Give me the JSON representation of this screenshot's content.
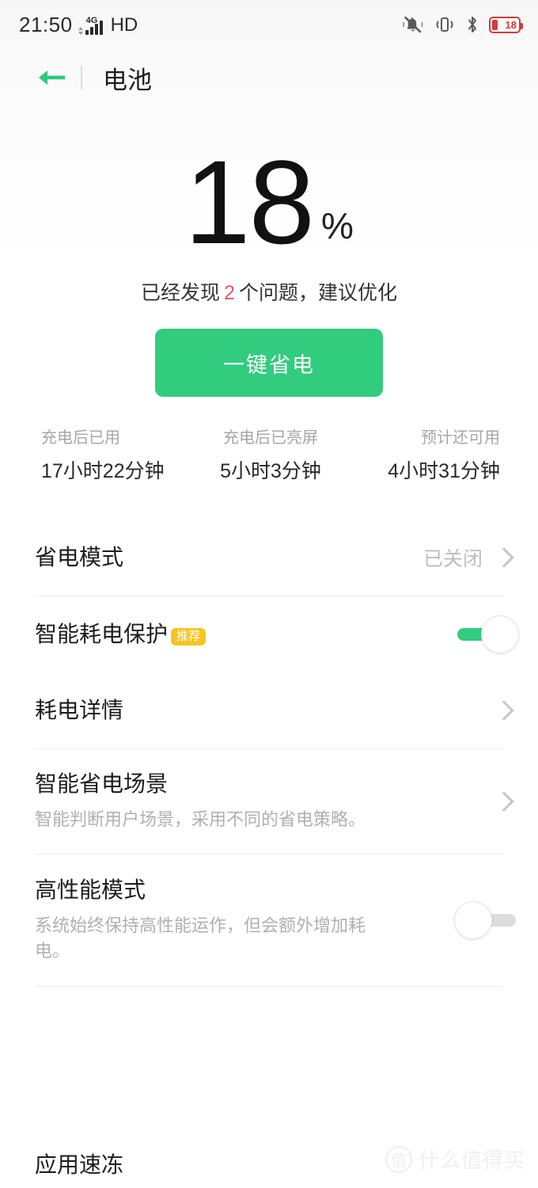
{
  "status_bar": {
    "time": "21:50",
    "network_type": "4G",
    "voice_label": "HD",
    "battery_percent": "18",
    "icons": [
      "ringer-mute-icon",
      "vibrate-icon",
      "bluetooth-icon",
      "battery-icon"
    ]
  },
  "app_bar": {
    "back_label": "back-arrow",
    "title": "电池"
  },
  "hero": {
    "battery_level": "18",
    "percent_symbol": "%",
    "issue_prefix": "已经发现",
    "issue_count": "2",
    "issue_suffix": "个问题，建议优化",
    "optimize_button": "一键省电",
    "accent_green": "#32cc7e",
    "issue_red": "#e25c6e"
  },
  "stats": [
    {
      "label": "充电后已用",
      "value": "17小时22分钟"
    },
    {
      "label": "充电后已亮屏",
      "value": "5小时3分钟"
    },
    {
      "label": "预计还可用",
      "value": "4小时31分钟"
    }
  ],
  "list": {
    "power_saving_mode": {
      "title": "省电模式",
      "value": "已关闭"
    },
    "smart_power_protection": {
      "title": "智能耗电保护",
      "badge": "推荐",
      "badge_color": "#f3c524",
      "toggle_state": "on"
    },
    "power_details": {
      "title": "耗电详情"
    },
    "smart_saving_scene": {
      "title": "智能省电场景",
      "subtitle": "智能判断用户场景，采用不同的省电策略。"
    },
    "high_performance_mode": {
      "title": "高性能模式",
      "subtitle": "系统始终保持高性能运作，但会额外增加耗电。",
      "toggle_state": "off"
    },
    "app_freeze": {
      "title": "应用速冻"
    }
  },
  "watermark": {
    "mark": "值",
    "text": "什么值得买"
  }
}
